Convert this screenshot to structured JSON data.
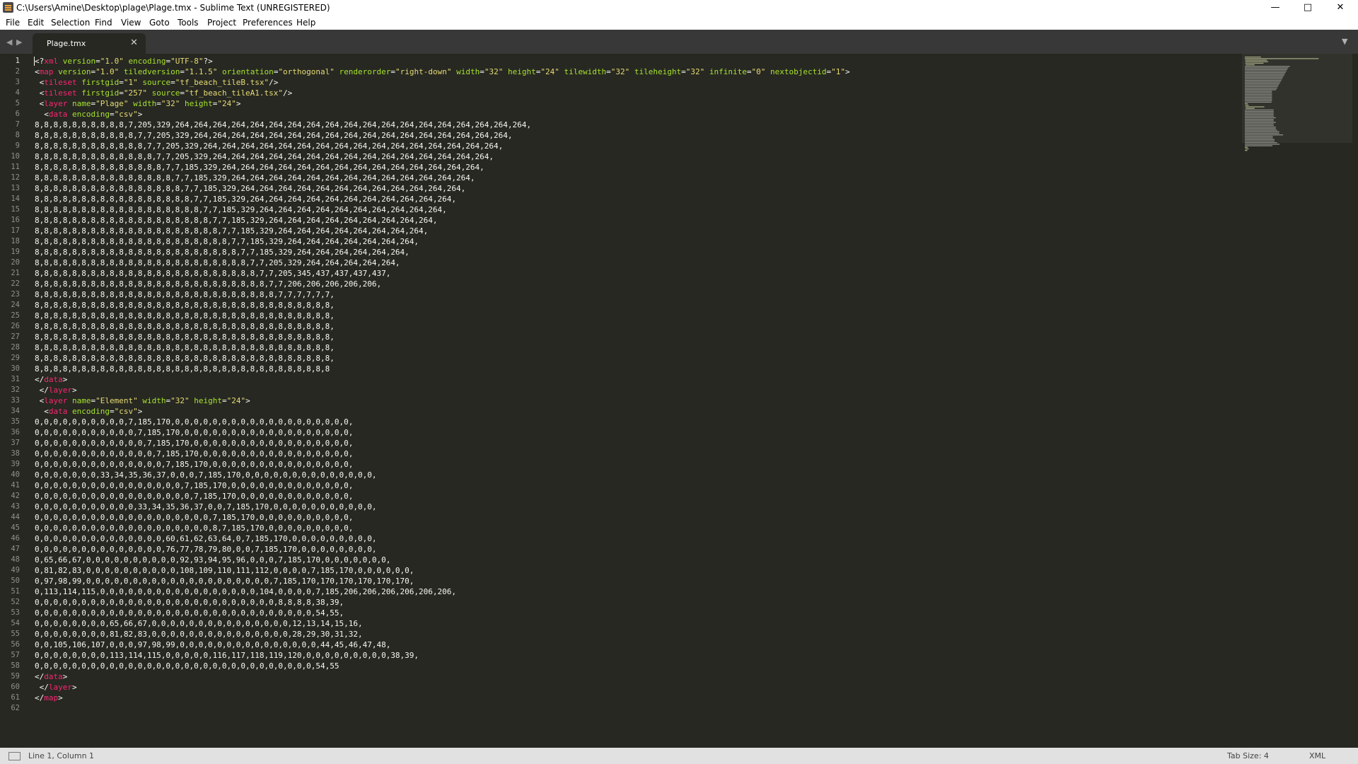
{
  "window": {
    "title": "C:\\Users\\Amine\\Desktop\\plage\\Plage.tmx - Sublime Text (UNREGISTERED)",
    "controls": {
      "minimize": "—",
      "maximize": "□",
      "close": "✕"
    }
  },
  "menu": [
    "File",
    "Edit",
    "Selection",
    "Find",
    "View",
    "Goto",
    "Tools",
    "Project",
    "Preferences",
    "Help"
  ],
  "tabs": [
    {
      "label": "Plage.tmx",
      "close": "✕"
    }
  ],
  "tab_nav": {
    "back": "◀",
    "forward": "▶",
    "dropdown": "▼"
  },
  "editor": {
    "line_numbers": [
      "1",
      "2",
      "3",
      "4",
      "5",
      "6",
      "7",
      "8",
      "9",
      "10",
      "11",
      "12",
      "13",
      "14",
      "15",
      "16",
      "17",
      "18",
      "19",
      "20",
      "21",
      "22",
      "23",
      "24",
      "25",
      "26",
      "27",
      "28",
      "29",
      "30",
      "31",
      "32",
      "33",
      "34",
      "35",
      "36",
      "37",
      "38",
      "39",
      "40",
      "41",
      "42",
      "43",
      "44",
      "45",
      "46",
      "47",
      "48",
      "49",
      "50",
      "51",
      "52",
      "53",
      "54",
      "55",
      "56",
      "57",
      "58",
      "59",
      "60",
      "61",
      "62"
    ],
    "lines": [
      "<?xml version=\"1.0\" encoding=\"UTF-8\"?>",
      "<map version=\"1.0\" tiledversion=\"1.1.5\" orientation=\"orthogonal\" renderorder=\"right-down\" width=\"32\" height=\"24\" tilewidth=\"32\" tileheight=\"32\" infinite=\"0\" nextobjectid=\"1\">",
      " <tileset firstgid=\"1\" source=\"tf_beach_tileB.tsx\"/>",
      " <tileset firstgid=\"257\" source=\"tf_beach_tileA1.tsx\"/>",
      " <layer name=\"Plage\" width=\"32\" height=\"24\">",
      "  <data encoding=\"csv\">",
      "8,8,8,8,8,8,8,8,8,8,7,205,329,264,264,264,264,264,264,264,264,264,264,264,264,264,264,264,264,264,264,264,",
      "8,8,8,8,8,8,8,8,8,8,8,7,7,205,329,264,264,264,264,264,264,264,264,264,264,264,264,264,264,264,264,264,",
      "8,8,8,8,8,8,8,8,8,8,8,8,7,7,205,329,264,264,264,264,264,264,264,264,264,264,264,264,264,264,264,264,",
      "8,8,8,8,8,8,8,8,8,8,8,8,8,7,7,205,329,264,264,264,264,264,264,264,264,264,264,264,264,264,264,264,",
      "8,8,8,8,8,8,8,8,8,8,8,8,8,8,7,7,185,329,264,264,264,264,264,264,264,264,264,264,264,264,264,264,",
      "8,8,8,8,8,8,8,8,8,8,8,8,8,8,8,7,7,185,329,264,264,264,264,264,264,264,264,264,264,264,264,264,",
      "8,8,8,8,8,8,8,8,8,8,8,8,8,8,8,8,7,7,185,329,264,264,264,264,264,264,264,264,264,264,264,264,",
      "8,8,8,8,8,8,8,8,8,8,8,8,8,8,8,8,8,7,7,185,329,264,264,264,264,264,264,264,264,264,264,264,",
      "8,8,8,8,8,8,8,8,8,8,8,8,8,8,8,8,8,8,7,7,185,329,264,264,264,264,264,264,264,264,264,264,",
      "8,8,8,8,8,8,8,8,8,8,8,8,8,8,8,8,8,8,8,7,7,185,329,264,264,264,264,264,264,264,264,264,",
      "8,8,8,8,8,8,8,8,8,8,8,8,8,8,8,8,8,8,8,8,7,7,185,329,264,264,264,264,264,264,264,264,",
      "8,8,8,8,8,8,8,8,8,8,8,8,8,8,8,8,8,8,8,8,8,7,7,185,329,264,264,264,264,264,264,264,",
      "8,8,8,8,8,8,8,8,8,8,8,8,8,8,8,8,8,8,8,8,8,8,7,7,185,329,264,264,264,264,264,264,",
      "8,8,8,8,8,8,8,8,8,8,8,8,8,8,8,8,8,8,8,8,8,8,8,7,7,205,329,264,264,264,264,264,",
      "8,8,8,8,8,8,8,8,8,8,8,8,8,8,8,8,8,8,8,8,8,8,8,8,7,7,205,345,437,437,437,437,",
      "8,8,8,8,8,8,8,8,8,8,8,8,8,8,8,8,8,8,8,8,8,8,8,8,8,7,7,206,206,206,206,206,",
      "8,8,8,8,8,8,8,8,8,8,8,8,8,8,8,8,8,8,8,8,8,8,8,8,8,8,7,7,7,7,7,7,",
      "8,8,8,8,8,8,8,8,8,8,8,8,8,8,8,8,8,8,8,8,8,8,8,8,8,8,8,8,8,8,8,8,",
      "8,8,8,8,8,8,8,8,8,8,8,8,8,8,8,8,8,8,8,8,8,8,8,8,8,8,8,8,8,8,8,8,",
      "8,8,8,8,8,8,8,8,8,8,8,8,8,8,8,8,8,8,8,8,8,8,8,8,8,8,8,8,8,8,8,8,",
      "8,8,8,8,8,8,8,8,8,8,8,8,8,8,8,8,8,8,8,8,8,8,8,8,8,8,8,8,8,8,8,8,",
      "8,8,8,8,8,8,8,8,8,8,8,8,8,8,8,8,8,8,8,8,8,8,8,8,8,8,8,8,8,8,8,8,",
      "8,8,8,8,8,8,8,8,8,8,8,8,8,8,8,8,8,8,8,8,8,8,8,8,8,8,8,8,8,8,8,8,",
      "8,8,8,8,8,8,8,8,8,8,8,8,8,8,8,8,8,8,8,8,8,8,8,8,8,8,8,8,8,8,8,8",
      "</data>",
      " </layer>",
      " <layer name=\"Element\" width=\"32\" height=\"24\">",
      "  <data encoding=\"csv\">",
      "0,0,0,0,0,0,0,0,0,0,7,185,170,0,0,0,0,0,0,0,0,0,0,0,0,0,0,0,0,0,0,0,",
      "0,0,0,0,0,0,0,0,0,0,0,7,185,170,0,0,0,0,0,0,0,0,0,0,0,0,0,0,0,0,0,0,",
      "0,0,0,0,0,0,0,0,0,0,0,0,7,185,170,0,0,0,0,0,0,0,0,0,0,0,0,0,0,0,0,0,",
      "0,0,0,0,0,0,0,0,0,0,0,0,0,7,185,170,0,0,0,0,0,0,0,0,0,0,0,0,0,0,0,0,",
      "0,0,0,0,0,0,0,0,0,0,0,0,0,0,7,185,170,0,0,0,0,0,0,0,0,0,0,0,0,0,0,0,",
      "0,0,0,0,0,0,0,33,34,35,36,37,0,0,0,7,185,170,0,0,0,0,0,0,0,0,0,0,0,0,0,0,",
      "0,0,0,0,0,0,0,0,0,0,0,0,0,0,0,0,7,185,170,0,0,0,0,0,0,0,0,0,0,0,0,0,",
      "0,0,0,0,0,0,0,0,0,0,0,0,0,0,0,0,0,7,185,170,0,0,0,0,0,0,0,0,0,0,0,0,",
      "0,0,0,0,0,0,0,0,0,0,0,33,34,35,36,37,0,0,7,185,170,0,0,0,0,0,0,0,0,0,0,0,",
      "0,0,0,0,0,0,0,0,0,0,0,0,0,0,0,0,0,0,0,7,185,170,0,0,0,0,0,0,0,0,0,0,",
      "0,0,0,0,0,0,0,0,0,0,0,0,0,0,0,0,0,0,0,8,7,185,170,0,0,0,0,0,0,0,0,0,",
      "0,0,0,0,0,0,0,0,0,0,0,0,0,0,60,61,62,63,64,0,7,185,170,0,0,0,0,0,0,0,0,0,",
      "0,0,0,0,0,0,0,0,0,0,0,0,0,0,76,77,78,79,80,0,0,7,185,170,0,0,0,0,0,0,0,0,",
      "0,65,66,67,0,0,0,0,0,0,0,0,0,0,92,93,94,95,96,0,0,0,7,185,170,0,0,0,0,0,0,0,",
      "0,81,82,83,0,0,0,0,0,0,0,0,0,0,108,109,110,111,112,0,0,0,0,7,185,170,0,0,0,0,0,0,",
      "0,97,98,99,0,0,0,0,0,0,0,0,0,0,0,0,0,0,0,0,0,0,0,0,7,185,170,170,170,170,170,170,",
      "0,113,114,115,0,0,0,0,0,0,0,0,0,0,0,0,0,0,0,0,0,104,0,0,0,0,7,185,206,206,206,206,206,206,",
      "0,0,0,0,0,0,0,0,0,0,0,0,0,0,0,0,0,0,0,0,0,0,0,0,0,0,8,8,8,8,38,39,",
      "0,0,0,0,0,0,0,0,0,0,0,0,0,0,0,0,0,0,0,0,0,0,0,0,0,0,0,0,0,0,54,55,",
      "0,0,0,0,0,0,0,0,65,66,67,0,0,0,0,0,0,0,0,0,0,0,0,0,0,0,12,13,14,15,16,",
      "0,0,0,0,0,0,0,0,81,82,83,0,0,0,0,0,0,0,0,0,0,0,0,0,0,0,28,29,30,31,32,",
      "0,0,105,106,107,0,0,0,97,98,99,0,0,0,0,0,0,0,0,0,0,0,0,0,0,0,44,45,46,47,48,",
      "0,0,0,0,0,0,0,0,113,114,115,0,0,0,0,0,116,117,118,119,120,0,0,0,0,0,0,0,0,0,38,39,",
      "0,0,0,0,0,0,0,0,0,0,0,0,0,0,0,0,0,0,0,0,0,0,0,0,0,0,0,0,0,0,54,55",
      "</data>",
      " </layer>",
      "</map>",
      ""
    ]
  },
  "status": {
    "position": "Line 1, Column 1",
    "tab_size": "Tab Size: 4",
    "syntax": "XML"
  },
  "colors": {
    "editor_bg": "#272822",
    "tag": "#f92672",
    "attribute": "#a6e22e",
    "string": "#e6db74",
    "text": "#f8f8f2"
  },
  "icons": [
    "app-icon",
    "minimize-icon",
    "maximize-icon",
    "close-icon",
    "nav-back-icon",
    "nav-forward-icon",
    "tab-close-icon",
    "tab-dropdown-icon",
    "panel-toggle-icon"
  ]
}
